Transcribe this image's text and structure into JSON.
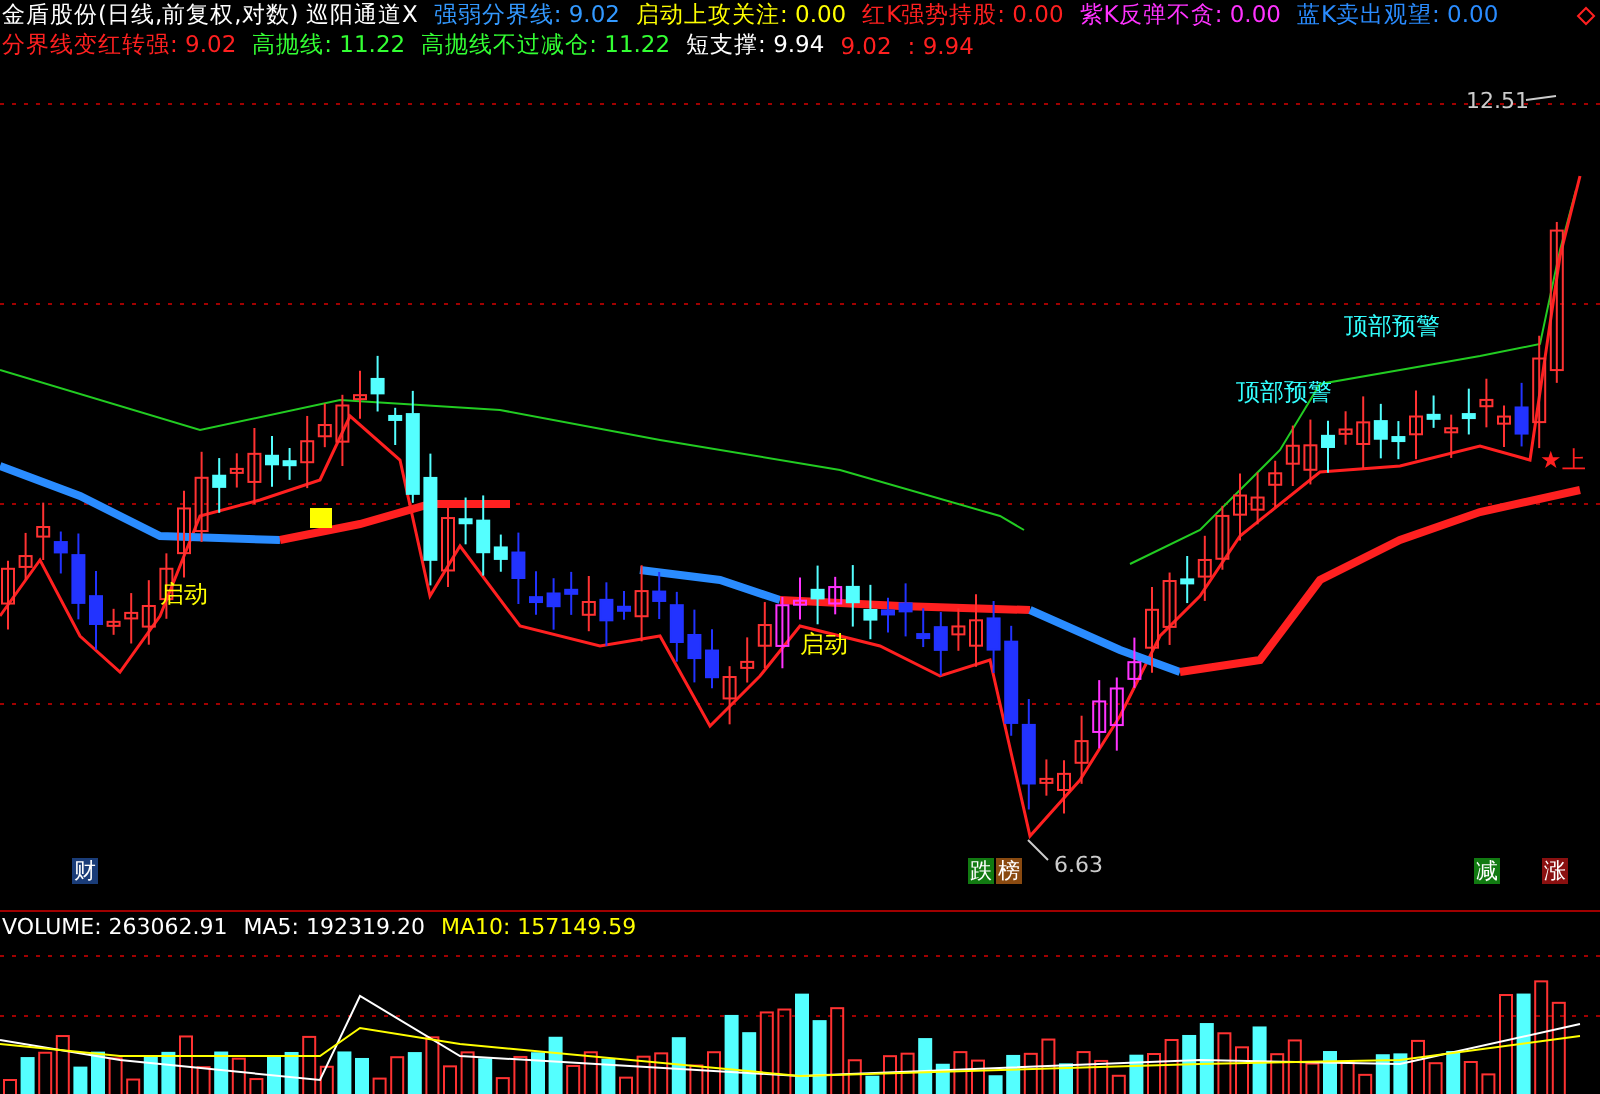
{
  "title": "金盾股份(日线,前复权,对数) 巡阳通道X",
  "header_line_1": [
    {
      "text": "强弱分界线: 9.02",
      "color": "#3399ff"
    },
    {
      "text": "启动上攻关注: 0.00",
      "color": "#ffff00"
    },
    {
      "text": "红K强势持股: 0.00",
      "color": "#ff2020"
    },
    {
      "text": "紫K反弹不贪: 0.00",
      "color": "#ff33ff"
    },
    {
      "text": "蓝K卖出观望: 0.00",
      "color": "#2a8cff"
    }
  ],
  "header_line_2": [
    {
      "text": "分界线变红转强: 9.02",
      "color": "#ff2020"
    },
    {
      "text": "高抛线: 11.22",
      "color": "#33ff33"
    },
    {
      "text": "高抛线不过减仓: 11.22",
      "color": "#33ff33"
    },
    {
      "text": "短支撑: 9.94",
      "color": "#ffffff"
    },
    {
      "text": "9.02",
      "color": "#ff2020"
    },
    {
      "text": ": 9.94",
      "color": "#ff2020"
    }
  ],
  "annotations": [
    {
      "kind": "price",
      "text": "12.51"
    },
    {
      "kind": "price",
      "text": "6.63"
    },
    {
      "kind": "signal",
      "text": "启动",
      "color": "#ffff00"
    },
    {
      "kind": "signal",
      "text": "启动",
      "color": "#ffff00"
    },
    {
      "kind": "signal",
      "text": "顶部预警",
      "color": "#33ffff"
    },
    {
      "kind": "signal",
      "text": "顶部预警",
      "color": "#33ffff"
    },
    {
      "kind": "star",
      "text": "★上",
      "color": "#ff2020"
    }
  ],
  "event_badges": [
    {
      "text": "财",
      "color": "#1a3c78"
    },
    {
      "text": "跌",
      "color": "#117a11"
    },
    {
      "text": "榜",
      "color": "#8a4a10"
    },
    {
      "text": "减",
      "color": "#117a11"
    },
    {
      "text": "涨",
      "color": "#8a1010"
    }
  ],
  "volume_header": [
    {
      "text": "VOLUME: 263062.91",
      "color": "#ffffff"
    },
    {
      "text": "MA5: 192319.20",
      "color": "#ffffff"
    },
    {
      "text": "MA10: 157149.59",
      "color": "#ffff00"
    }
  ]
}
